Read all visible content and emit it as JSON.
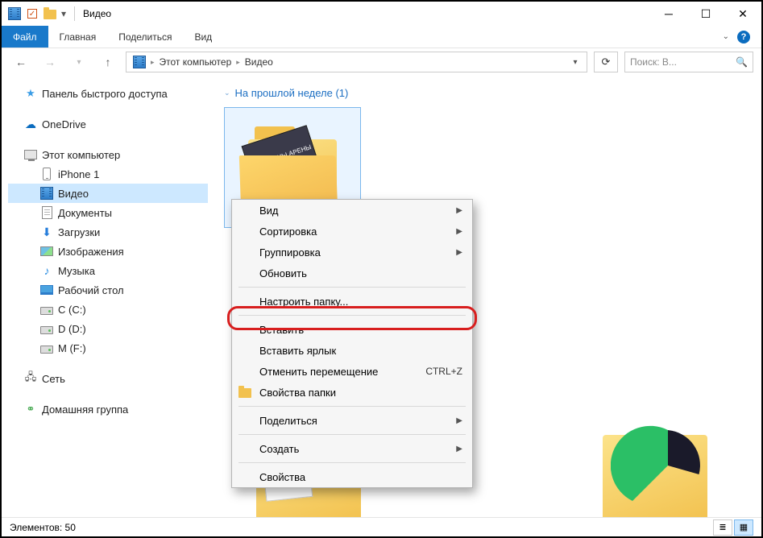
{
  "title": "Видео",
  "ribbon": {
    "file": "Файл",
    "tabs": [
      "Главная",
      "Поделиться",
      "Вид"
    ]
  },
  "breadcrumb": {
    "root": "Этот компьютер",
    "current": "Видео"
  },
  "search_placeholder": "Поиск: В...",
  "sidebar": {
    "quick": "Панель быстрого доступа",
    "onedrive": "OneDrive",
    "this_pc": "Этот компьютер",
    "pc_children": [
      {
        "label": "iPhone 1",
        "icon": "phone"
      },
      {
        "label": "Видео",
        "icon": "video",
        "selected": true
      },
      {
        "label": "Документы",
        "icon": "doc"
      },
      {
        "label": "Загрузки",
        "icon": "down"
      },
      {
        "label": "Изображения",
        "icon": "img"
      },
      {
        "label": "Музыка",
        "icon": "music"
      },
      {
        "label": "Рабочий стол",
        "icon": "desk"
      },
      {
        "label": "C (C:)",
        "icon": "drive"
      },
      {
        "label": "D (D:)",
        "icon": "drive"
      },
      {
        "label": "M (F:)",
        "icon": "drive"
      }
    ],
    "network": "Сеть",
    "homegroup": "Домашняя группа"
  },
  "group_header": "На прошлой неделе (1)",
  "folder_thumb_text": "ЧЕМПИОНЫ АРЕНЫ",
  "context_menu": {
    "view": "Вид",
    "sort": "Сортировка",
    "group": "Группировка",
    "refresh": "Обновить",
    "customize": "Настроить папку...",
    "paste": "Вставить",
    "paste_shortcut": "Вставить ярлык",
    "undo_move": "Отменить перемещение",
    "undo_shortcut": "CTRL+Z",
    "folder_props": "Свойства папки",
    "share": "Поделиться",
    "create": "Создать",
    "properties": "Свойства"
  },
  "statusbar": "Элементов: 50"
}
